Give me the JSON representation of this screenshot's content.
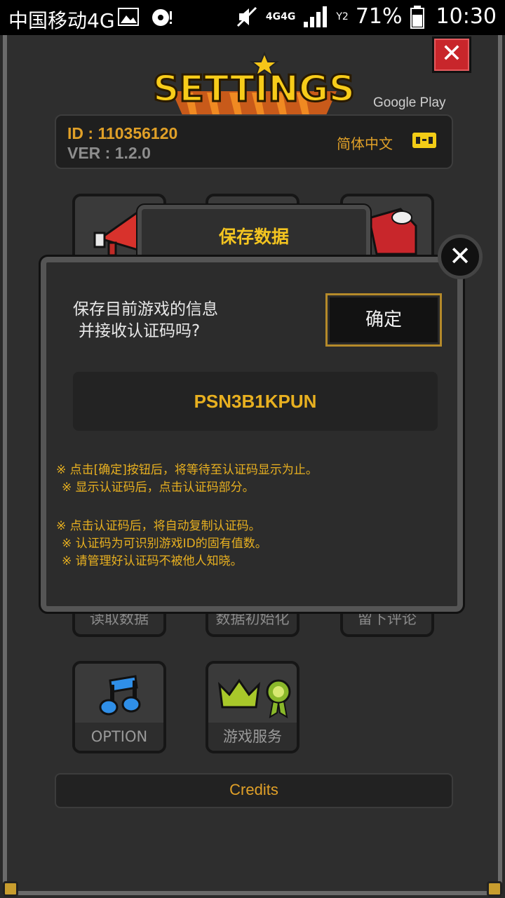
{
  "status_bar": {
    "carrier": "中国移动4G",
    "network": "4G4G",
    "sim": "Y2",
    "battery_pct": "71%",
    "time": "10:30"
  },
  "header": {
    "title": "SETTINGS",
    "google_play": "Google Play",
    "close_icon": "close-icon"
  },
  "info": {
    "id": "ID : 110356120",
    "version": "VER : 1.2.0",
    "language": "简体中文"
  },
  "menu": {
    "row2": [
      "读取数据",
      "数据初始化",
      "留下评论"
    ],
    "row3": [
      "OPTION",
      "游戏服务"
    ]
  },
  "dialog": {
    "title": "保存数据",
    "message_line1": "保存目前游戏的信息",
    "message_line2": "并接收认证码吗?",
    "confirm_label": "确定",
    "code": "PSN3B1KPUN",
    "notes": [
      "※ 点击[确定]按钮后，将等待至认证码显示为止。",
      "※ 显示认证码后，点击认证码部分。",
      "※ 点击认证码后，将自动复制认证码。",
      "※ 认证码为可识别游戏ID的固有值数。",
      "※ 请管理好认证码不被他人知晓。"
    ]
  },
  "footer": {
    "credits": "Credits"
  },
  "colors": {
    "accent": "#e0a028",
    "title_yellow": "#f3c420",
    "close_red": "#c8262b"
  }
}
